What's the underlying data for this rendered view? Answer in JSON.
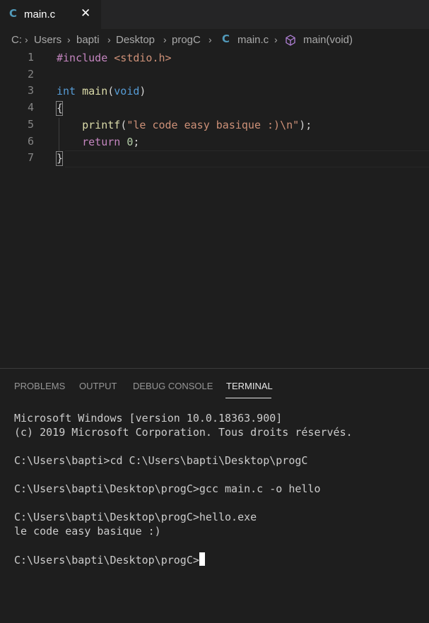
{
  "tab": {
    "icon": "C",
    "label": "main.c",
    "close": "✕"
  },
  "breadcrumb": {
    "items": [
      "C:",
      "Users",
      "bapti",
      "Desktop",
      "progC",
      "main.c",
      "main(void)"
    ],
    "file_icon": "C",
    "separator": "›"
  },
  "editor": {
    "line_numbers": [
      "1",
      "2",
      "3",
      "4",
      "5",
      "6",
      "7"
    ],
    "lines": {
      "l1_directive": "#include",
      "l1_header": " <stdio.h>",
      "l3_type": "int",
      "l3_name": " main",
      "l3_open": "(",
      "l3_param": "void",
      "l3_close": ")",
      "l4": "{",
      "l5_indent": "    ",
      "l5_fn": "printf",
      "l5_open": "(",
      "l5_str": "\"le code easy basique :)\\n\"",
      "l5_close": ");",
      "l6_indent": "    ",
      "l6_kw": "return",
      "l6_space": " ",
      "l6_num": "0",
      "l6_end": ";",
      "l7": "}"
    }
  },
  "panel": {
    "tabs": [
      "PROBLEMS",
      "OUTPUT",
      "DEBUG CONSOLE",
      "TERMINAL"
    ],
    "active_tab": "TERMINAL",
    "terminal_lines": [
      "Microsoft Windows [version 10.0.18363.900]",
      "(c) 2019 Microsoft Corporation. Tous droits réservés.",
      "",
      "C:\\Users\\bapti>cd C:\\Users\\bapti\\Desktop\\progC",
      "",
      "C:\\Users\\bapti\\Desktop\\progC>gcc main.c -o hello",
      "",
      "C:\\Users\\bapti\\Desktop\\progC>hello.exe",
      "le code easy basique :)",
      "",
      "C:\\Users\\bapti\\Desktop\\progC>"
    ]
  },
  "colors": {
    "background": "#1e1e1e",
    "c_icon": "#519aba",
    "symbol_icon": "#b180d7"
  }
}
